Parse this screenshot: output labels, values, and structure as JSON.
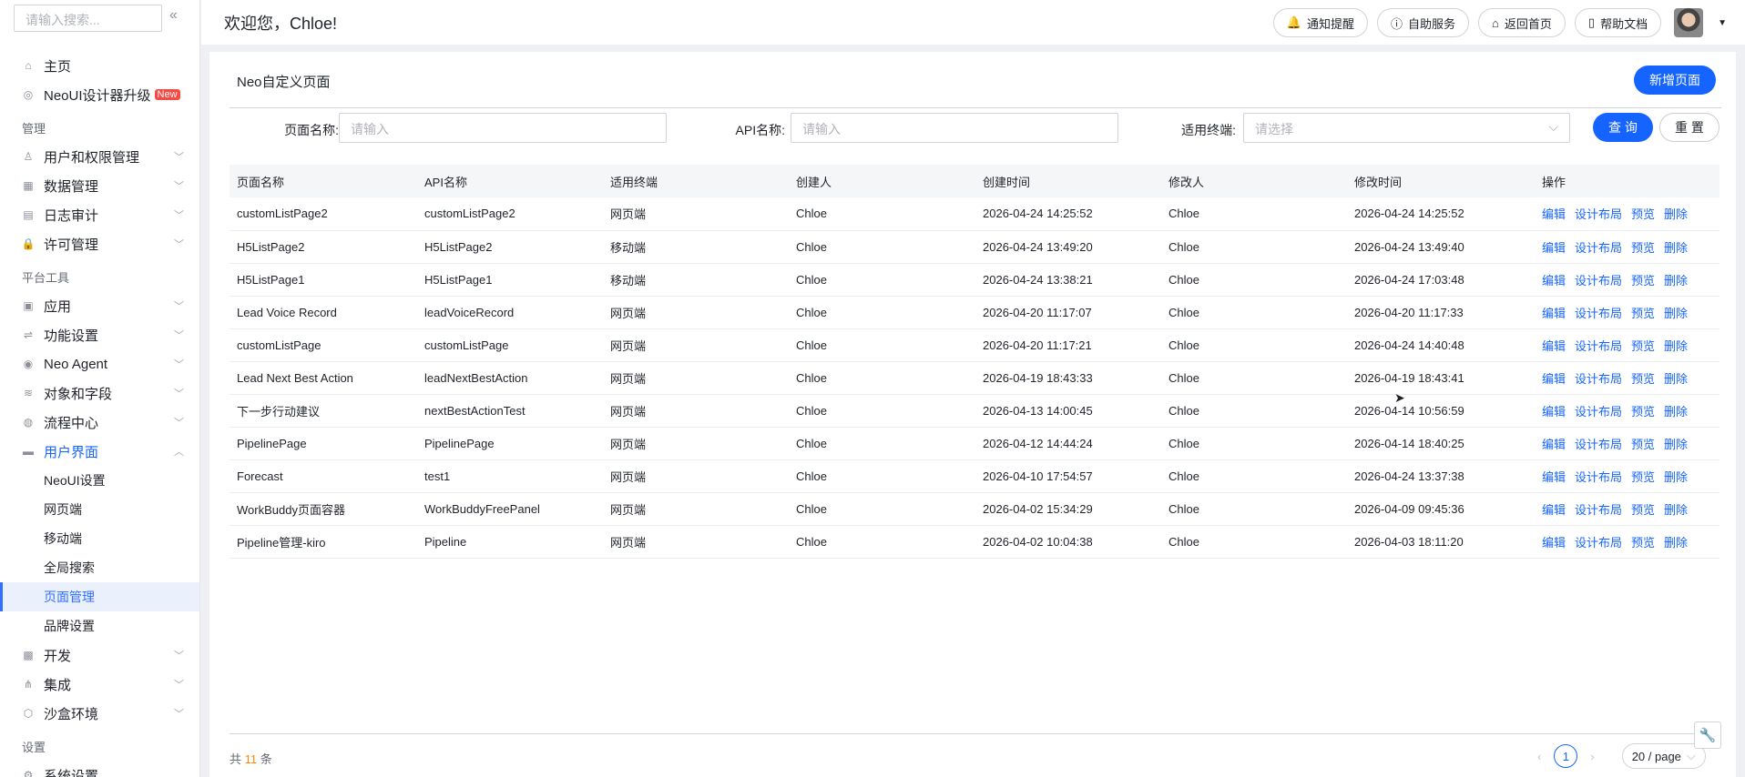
{
  "sidebar": {
    "search_placeholder": "请输入搜索...",
    "top": [
      {
        "label": "主页",
        "icon": "home-icon"
      },
      {
        "label": "NeoUI设计器升级",
        "badge": "New",
        "icon": "upgrade-icon"
      }
    ],
    "groups": [
      {
        "label": "管理",
        "items": [
          {
            "label": "用户和权限管理",
            "icon": "users-icon"
          },
          {
            "label": "数据管理",
            "icon": "data-icon"
          },
          {
            "label": "日志审计",
            "icon": "log-icon"
          },
          {
            "label": "许可管理",
            "icon": "lock-icon"
          }
        ]
      },
      {
        "label": "平台工具",
        "items": [
          {
            "label": "应用",
            "icon": "apps-icon"
          },
          {
            "label": "功能设置",
            "icon": "sliders-icon"
          },
          {
            "label": "Neo Agent",
            "icon": "agent-icon"
          },
          {
            "label": "对象和字段",
            "icon": "layers-icon"
          },
          {
            "label": "流程中心",
            "icon": "flow-icon"
          }
        ]
      }
    ],
    "expanded": {
      "label": "用户界面",
      "icon": "monitor-icon",
      "children": [
        "NeoUI设置",
        "网页端",
        "移动端",
        "全局搜索",
        "页面管理",
        "品牌设置"
      ],
      "active": "页面管理"
    },
    "after": [
      {
        "label": "开发",
        "icon": "dev-icon"
      },
      {
        "label": "集成",
        "icon": "integration-icon"
      },
      {
        "label": "沙盒环境",
        "icon": "sandbox-icon"
      }
    ],
    "settings_group": "设置",
    "settings_item": "系统设置"
  },
  "header": {
    "title": "欢迎您，Chloe!",
    "buttons": [
      {
        "label": "通知提醒",
        "icon": "bell-icon"
      },
      {
        "label": "自助服务",
        "icon": "info-icon"
      },
      {
        "label": "返回首页",
        "icon": "home-icon"
      },
      {
        "label": "帮助文档",
        "icon": "doc-icon"
      }
    ]
  },
  "card": {
    "title": "Neo自定义页面",
    "new_button": "新增页面"
  },
  "filters": {
    "page_name_label": "页面名称:",
    "page_name_placeholder": "请输入",
    "api_name_label": "API名称:",
    "api_name_placeholder": "请输入",
    "terminal_label": "适用终端:",
    "terminal_placeholder": "请选择",
    "query": "查 询",
    "reset": "重 置"
  },
  "table": {
    "columns": [
      "页面名称",
      "API名称",
      "适用终端",
      "创建人",
      "创建时间",
      "修改人",
      "修改时间",
      "操作"
    ],
    "actions": [
      "编辑",
      "设计布局",
      "预览",
      "删除"
    ],
    "rows": [
      [
        "customListPage2",
        "customListPage2",
        "网页端",
        "Chloe",
        "2026-04-24 14:25:52",
        "Chloe",
        "2026-04-24 14:25:52"
      ],
      [
        "H5ListPage2",
        "H5ListPage2",
        "移动端",
        "Chloe",
        "2026-04-24 13:49:20",
        "Chloe",
        "2026-04-24 13:49:40"
      ],
      [
        "H5ListPage1",
        "H5ListPage1",
        "移动端",
        "Chloe",
        "2026-04-24 13:38:21",
        "Chloe",
        "2026-04-24 17:03:48"
      ],
      [
        "Lead Voice Record",
        "leadVoiceRecord",
        "网页端",
        "Chloe",
        "2026-04-20 11:17:07",
        "Chloe",
        "2026-04-20 11:17:33"
      ],
      [
        "customListPage",
        "customListPage",
        "网页端",
        "Chloe",
        "2026-04-20 11:17:21",
        "Chloe",
        "2026-04-24 14:40:48"
      ],
      [
        "Lead Next Best Action",
        "leadNextBestAction",
        "网页端",
        "Chloe",
        "2026-04-19 18:43:33",
        "Chloe",
        "2026-04-19 18:43:41"
      ],
      [
        "下一步行动建议",
        "nextBestActionTest",
        "网页端",
        "Chloe",
        "2026-04-13 14:00:45",
        "Chloe",
        "2026-04-14 10:56:59"
      ],
      [
        "PipelinePage",
        "PipelinePage",
        "网页端",
        "Chloe",
        "2026-04-12 14:44:24",
        "Chloe",
        "2026-04-14 18:40:25"
      ],
      [
        "Forecast",
        "test1",
        "网页端",
        "Chloe",
        "2026-04-10 17:54:57",
        "Chloe",
        "2026-04-24 13:37:38"
      ],
      [
        "WorkBuddy页面容器",
        "WorkBuddyFreePanel",
        "网页端",
        "Chloe",
        "2026-04-02 15:34:29",
        "Chloe",
        "2026-04-09 09:45:36"
      ],
      [
        "Pipeline管理-kiro",
        "Pipeline",
        "网页端",
        "Chloe",
        "2026-04-02 10:04:38",
        "Chloe",
        "2026-04-03 18:11:20"
      ]
    ]
  },
  "footer": {
    "total_prefix": "共",
    "total": "11",
    "total_suffix": "条",
    "current_page": "1",
    "page_size": "20 / page"
  },
  "colors": {
    "primary": "#1664ff",
    "active_bg": "#eaf1fc",
    "badge": "#f54a45",
    "count": "#ff8800"
  }
}
